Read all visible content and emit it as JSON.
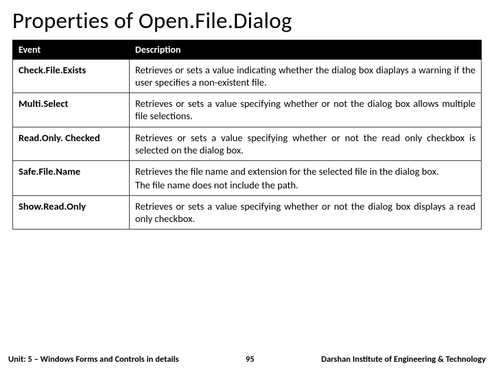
{
  "title": "Properties of Open.File.Dialog",
  "table": {
    "headers": {
      "event": "Event",
      "description": "Description"
    },
    "rows": [
      {
        "event": "Check.File.Exists",
        "description": "Retrieves or sets a value indicating whether the dialog box diaplays a warning if the user specifies a non-existent file."
      },
      {
        "event": "Multi.Select",
        "description": "Retrieves or sets a value specifying whether or not the dialog box allows multiple file selections."
      },
      {
        "event": "Read.Only. Checked",
        "description": "Retrieves or sets a value specifying whether or not the read only checkbox is selected on the dialog box."
      },
      {
        "event": "Safe.File.Name",
        "description": "Retrieves the file name and extension for the selected file in the dialog box.",
        "description2": "The file name does not include the path."
      },
      {
        "event": "Show.Read.Only",
        "description": "Retrieves or sets a value specifying whether or not the dialog box displays a read only checkbox."
      }
    ]
  },
  "footer": {
    "unit": "Unit: 5 – Windows Forms and Controls in details",
    "page": "95",
    "org": "Darshan Institute of Engineering & Technology"
  }
}
